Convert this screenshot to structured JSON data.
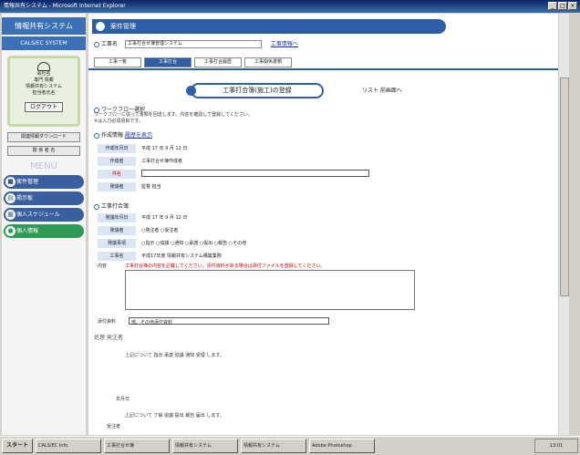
{
  "window": {
    "title": "情報共有システム - Microsoft Internet Explorer",
    "controls": [
      "_",
      "□",
      "×"
    ]
  },
  "sidebar": {
    "title": "情報共有システム",
    "subtitle": "CALS/EC SYSTEM",
    "user_line1": "会社名",
    "user_line2": "専門 情報",
    "user_line3": "情報共有システム",
    "user_line4": "担当者氏名",
    "logout": "ログアウト",
    "btn_download": "関連情報ダウンロード",
    "btn_list": "関 係 者 名",
    "menu_label": "MENU",
    "menu": [
      {
        "label": "案件管理",
        "icon": "document-icon"
      },
      {
        "label": "掲示板",
        "icon": "board-icon"
      },
      {
        "label": "個人スケジュール",
        "icon": "calendar-icon"
      },
      {
        "label": "個人情報",
        "icon": "person-icon"
      }
    ]
  },
  "main": {
    "banner": "案件管理",
    "koji_label": "工事名",
    "koji_value": "工事打合せ簿管理システム",
    "koji_link": "工事情報へ",
    "tabs": [
      "工事一覧",
      "工事打合",
      "工事打合履歴",
      "工事関係書類"
    ],
    "section_title": "工事打合簿(施工)の登録",
    "section_right": "リスト 前画面へ",
    "workflow": "ワークフロー選択",
    "note1": "ワークフローに従って書類を回送します。内容を確認して登録してください。",
    "note2": "※は入力必須項目です。",
    "sakusei": "作成情報",
    "sakusei_link": "履歴を表示",
    "fields": [
      {
        "label": "作成年月日",
        "value": "平成 17 年 9 月 12 日"
      },
      {
        "label": "作成者",
        "value": "工事打合せ簿作成者"
      },
      {
        "label": "件名",
        "value": ""
      },
      {
        "label": "発議者",
        "value": "監督 担当"
      }
    ],
    "uchiawase": "工事打合簿",
    "fields2": [
      {
        "label": "発議年月日",
        "value": "平成 17 年 9 月 12 日"
      },
      {
        "label": "発議者",
        "value": "○発注者 ○受注者"
      },
      {
        "label": "発議事項",
        "value": "○指示 ○協議 ○通知 ○承諾 ○提出 ○報告 ○その他"
      },
      {
        "label": "工事名",
        "value": "平成17年度 情報共有システム構築業務"
      }
    ],
    "naiyou_label": "内容",
    "naiyou_red": "工事打合簿の内容を記載してください。添付資料がある場合は添付ファイルを登録してください。",
    "attach_label": "添付資料",
    "attach_value": "部、その他添付資料",
    "shori": "処理 発注者",
    "shori_rows": [
      "上記について 指示 承諾 協議 通知 受理 します。",
      "年月日",
      "上記について 了解 協議 提出 報告 届出 します。",
      "受注者"
    ]
  },
  "taskbar": {
    "start": "スタート",
    "tasks": [
      "CALS/EC Info",
      "工事打合せ簿",
      "情報共有システム",
      "情報共有システム",
      "Adobe Photoshop"
    ],
    "tray": "13:01"
  }
}
